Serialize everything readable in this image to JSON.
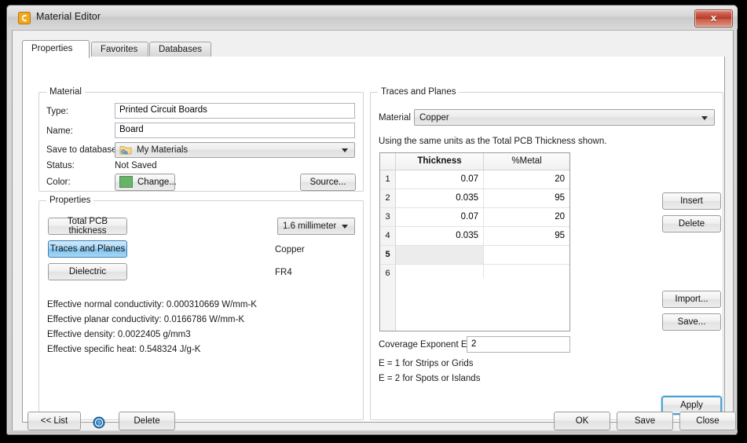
{
  "window": {
    "title": "Material Editor",
    "icon": "app-c-icon",
    "close_label": "x"
  },
  "tabs": [
    {
      "label": "Properties",
      "active": true
    },
    {
      "label": "Favorites",
      "active": false
    },
    {
      "label": "Databases",
      "active": false
    }
  ],
  "material_group": {
    "title": "Material",
    "type_label": "Type:",
    "type_value": "Printed Circuit Boards",
    "name_label": "Name:",
    "name_value": "Board",
    "save_to_database_label": "Save to database:",
    "save_to_database_value": "My Materials",
    "status_label": "Status:",
    "status_value": "Not Saved",
    "color_label": "Color:",
    "color_swatch_hex": "#68b36a",
    "change_button": "Change...",
    "source_button": "Source..."
  },
  "properties_group": {
    "title": "Properties",
    "buttons": [
      {
        "label": "Total PCB thickness",
        "selected": false
      },
      {
        "label": "Traces and Planes",
        "selected": true
      },
      {
        "label": "Dielectric",
        "selected": false
      }
    ],
    "thickness_value": "1.6 millimeter",
    "traces_value": "Copper",
    "dielectric_value": "FR4",
    "effective": [
      "Effective normal conductivity: 0.000310669 W/mm-K",
      "Effective planar conductivity: 0.0166786 W/mm-K",
      "Effective density: 0.0022405 g/mm3",
      "Effective specific heat: 0.548324 J/g-K"
    ]
  },
  "traces_group": {
    "title": "Traces and Planes",
    "material_label": "Material",
    "material_value": "Copper",
    "units_note": "Using the same units as the Total PCB Thickness shown.",
    "grid": {
      "columns": [
        "",
        "Thickness",
        "%Metal"
      ],
      "rows": [
        {
          "n": "1",
          "thickness": "0.07",
          "metal": "20",
          "selected": false
        },
        {
          "n": "2",
          "thickness": "0.035",
          "metal": "95",
          "selected": false
        },
        {
          "n": "3",
          "thickness": "0.07",
          "metal": "20",
          "selected": false
        },
        {
          "n": "4",
          "thickness": "0.035",
          "metal": "95",
          "selected": false
        },
        {
          "n": "5",
          "thickness": "",
          "metal": "",
          "selected": true
        },
        {
          "n": "6",
          "thickness": "",
          "metal": "",
          "selected": false
        }
      ]
    },
    "coverage_label": "Coverage Exponent E",
    "coverage_value": "2",
    "hint_1": "E = 1 for Strips or Grids",
    "hint_2": "E = 2 for Spots or Islands",
    "insert_button": "Insert",
    "delete_button": "Delete",
    "import_button": "Import...",
    "save_button": "Save...",
    "apply_button": "Apply"
  },
  "bottom_bar": {
    "list_button": "<< List",
    "help_icon": "help-circle-icon",
    "delete_button": "Delete",
    "ok_button": "OK",
    "save_button": "Save",
    "close_button": "Close"
  }
}
